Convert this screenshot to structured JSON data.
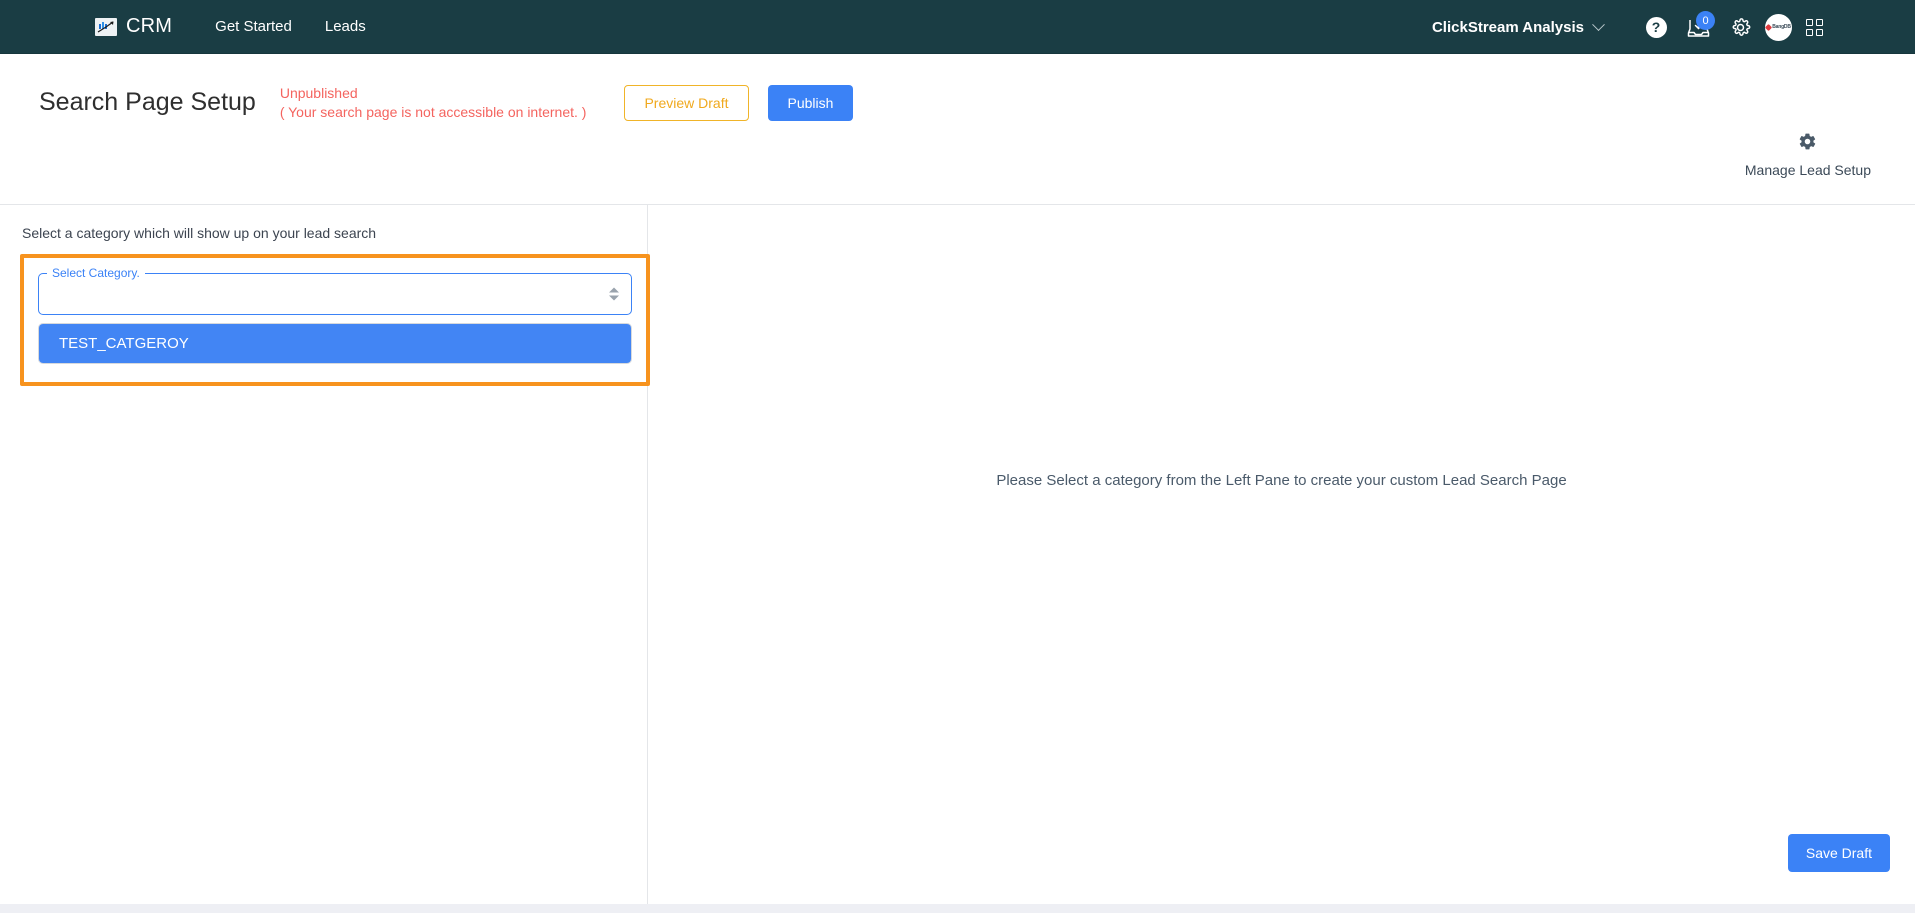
{
  "topnav": {
    "brand": {
      "logo_icon": "chart-arrow-logo-icon",
      "name": "CRM"
    },
    "links": [
      {
        "label": "Get Started"
      },
      {
        "label": "Leads"
      }
    ],
    "account": {
      "label": "ClickStream Analysis",
      "chevron_icon": "chevron-down-icon"
    },
    "help_icon_label": "?",
    "inbox": {
      "icon": "inbox-download-icon",
      "badge_count": "0"
    },
    "settings_icon": "gear-icon",
    "avatar": {
      "icon": "user-avatar",
      "text": "BangDB"
    },
    "apps_icon": "grid-apps-icon",
    "bg_color": "#1a3d44",
    "badge_color": "#3b82f6"
  },
  "page_header": {
    "title": "Search Page Setup",
    "status_main": "Unpublished",
    "status_sub": "( Your search page is not accessible on internet. )",
    "status_color": "#f4645f",
    "preview_label": "Preview Draft",
    "preview_color": "#f0a91e",
    "publish_label": "Publish",
    "publish_color": "#3b82f6",
    "manage": {
      "icon": "gear-icon",
      "label": "Manage Lead Setup"
    }
  },
  "left_pane": {
    "caption": "Select a category which will show up on your lead search",
    "highlight_color": "#f7931e",
    "select": {
      "floating_label": "Select Category.",
      "value": "",
      "placeholder": "",
      "caret_icon": "caret-updown-icon",
      "focus_color": "#3b82f6"
    },
    "options": [
      {
        "label": "TEST_CATGEROY",
        "selected": true
      }
    ],
    "option_highlight_color": "#4285f4"
  },
  "right_pane": {
    "empty_message": "Please Select a category from the Left Pane to create your custom Lead Search Page",
    "save_label": "Save Draft",
    "save_color": "#3b82f6"
  }
}
